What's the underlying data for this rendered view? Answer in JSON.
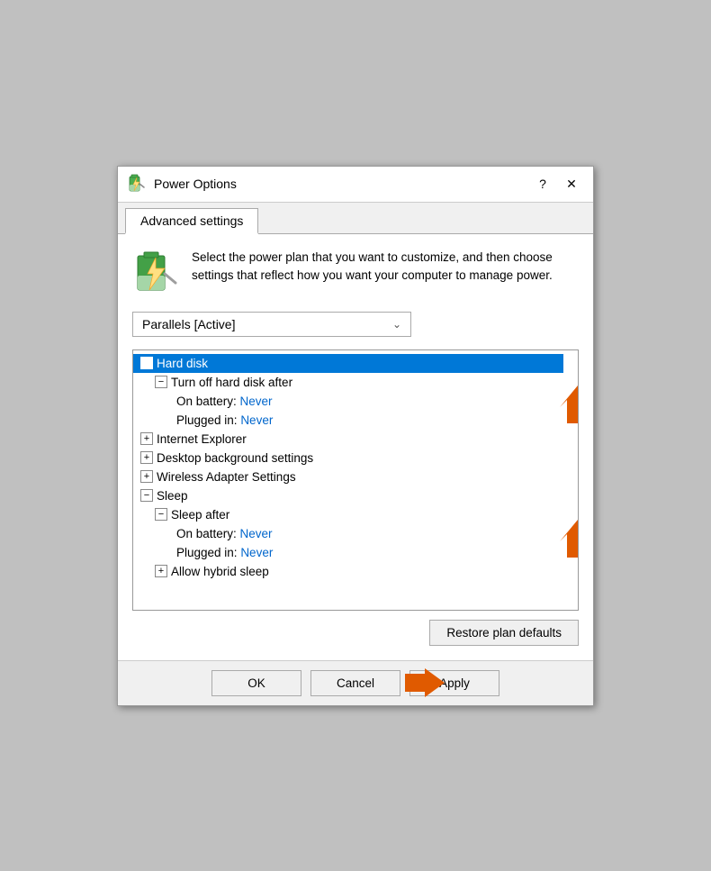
{
  "titleBar": {
    "title": "Power Options",
    "helpBtn": "?",
    "closeBtn": "✕"
  },
  "tabs": [
    {
      "label": "Advanced settings",
      "active": true
    }
  ],
  "description": "Select the power plan that you want to customize, and then choose settings that reflect how you want your computer to manage power.",
  "dropdown": {
    "value": "Parallels [Active]"
  },
  "tree": {
    "items": [
      {
        "level": 0,
        "toggle": "−",
        "label": "Hard disk",
        "selected": true
      },
      {
        "level": 1,
        "toggle": "−",
        "label": "Turn off hard disk after"
      },
      {
        "level": 2,
        "toggle": null,
        "label": "On battery: ",
        "value": "Never"
      },
      {
        "level": 2,
        "toggle": null,
        "label": "Plugged in: ",
        "value": "Never"
      },
      {
        "level": 0,
        "toggle": "+",
        "label": "Internet Explorer"
      },
      {
        "level": 0,
        "toggle": "+",
        "label": "Desktop background settings"
      },
      {
        "level": 0,
        "toggle": "+",
        "label": "Wireless Adapter Settings"
      },
      {
        "level": 0,
        "toggle": "−",
        "label": "Sleep"
      },
      {
        "level": 1,
        "toggle": "−",
        "label": "Sleep after"
      },
      {
        "level": 2,
        "toggle": null,
        "label": "On battery: ",
        "value": "Never"
      },
      {
        "level": 2,
        "toggle": null,
        "label": "Plugged in: ",
        "value": "Never"
      },
      {
        "level": 1,
        "toggle": "+",
        "label": "Allow hybrid sleep"
      }
    ]
  },
  "restoreBtn": "Restore plan defaults",
  "buttons": {
    "ok": "OK",
    "cancel": "Cancel",
    "apply": "Apply"
  },
  "colors": {
    "accent": "#0066cc",
    "selected": "#0078d7",
    "orange": "#e05a00"
  }
}
